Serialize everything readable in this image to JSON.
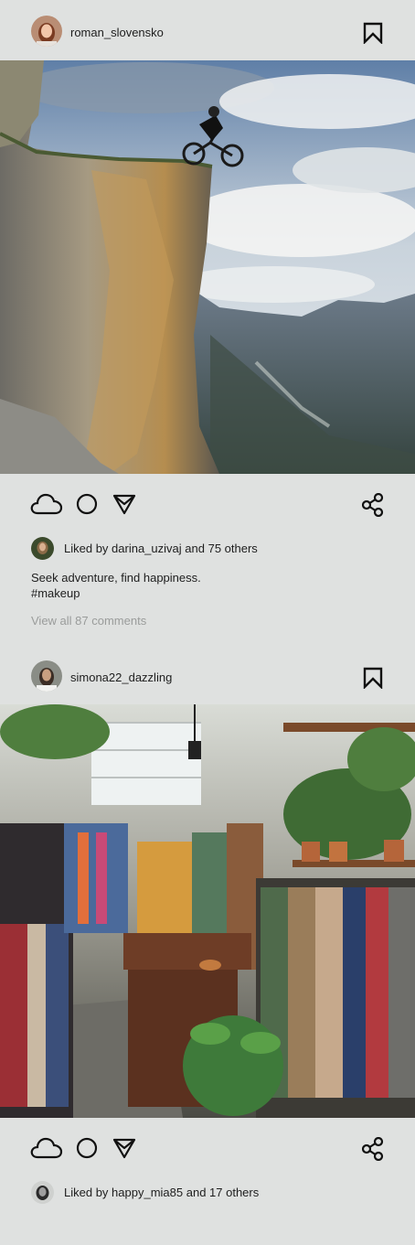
{
  "posts": [
    {
      "username": "roman_slovensko",
      "likes_user": "darina_uzivaj",
      "likes_suffix": "and 75 others",
      "caption_line1": "Seek adventure, find happiness.",
      "caption_line2": "#makeup",
      "view_comments": "View all 87 comments"
    },
    {
      "username": "simona22_dazzling",
      "likes_user": "happy_mia85",
      "likes_suffix": "and 17 others"
    }
  ],
  "likes_prefix": "Liked by",
  "icons": {
    "like": "cloud-icon",
    "comment": "circle-icon",
    "send": "send-icon",
    "share": "share-icon",
    "bookmark": "bookmark-icon"
  },
  "colors": {
    "background": "#dfe1e0",
    "text": "#1e1e1e",
    "muted": "#9a9c9b"
  }
}
